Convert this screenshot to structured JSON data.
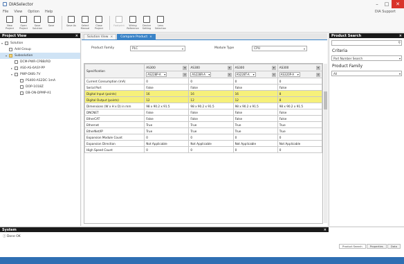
{
  "app": {
    "title": "DIASelector",
    "update_link": "DIA Support"
  },
  "menu": [
    "File",
    "View",
    "Option",
    "Help"
  ],
  "toolbar": [
    {
      "label": "New Project"
    },
    {
      "label": "Open Project"
    },
    {
      "label": "Save Solution"
    },
    {
      "label": "Save"
    },
    {
      "label": "Save As"
    },
    {
      "label": "Select Manual"
    },
    {
      "label": "Close Project"
    },
    {
      "label": "Footprint"
    },
    {
      "label": "Wiring Reference"
    },
    {
      "label": "Device Setting"
    },
    {
      "label": "Lens Selection"
    }
  ],
  "left_panel": {
    "title": "Project View",
    "nodes": [
      {
        "label": "Solution",
        "level": 0
      },
      {
        "label": "Add Group",
        "level": 1
      },
      {
        "label": "Subsolution",
        "level": 1
      },
      {
        "label": "DCM-PWR-CPBB/RD",
        "level": 2
      },
      {
        "label": "AS0-AS-6ASY-PP",
        "level": 2
      },
      {
        "label": "PWP-DI8S-7V",
        "level": 2
      },
      {
        "label": "PS400-AS2DC-1mA",
        "level": 3
      },
      {
        "label": "DOP-1018Z",
        "level": 3
      },
      {
        "label": "DB-ON-DPMP-A1",
        "level": 3
      }
    ]
  },
  "center": {
    "tabs": [
      {
        "label": "Solution View"
      },
      {
        "label": "Compare Product"
      }
    ],
    "filters": {
      "family_label": "Product Family",
      "family_value": "PLC",
      "type_label": "Module Type",
      "type_value": "CPU"
    },
    "columns": [
      {
        "series": "AS300",
        "model": "AS228P-A"
      },
      {
        "series": "AS300",
        "model": "AS228R-A"
      },
      {
        "series": "AS300",
        "model": "AS228T-A"
      },
      {
        "series": "AS300",
        "model": "AS320P-A"
      }
    ],
    "spec_header": "Specification",
    "rows": [
      {
        "label": "Current Consumption (mA)",
        "values": [
          "0",
          "0",
          "0",
          "0"
        ],
        "hl": false
      },
      {
        "label": "Serial Port",
        "values": [
          "False",
          "False",
          "False",
          "False"
        ],
        "hl": false
      },
      {
        "label": "Digital Input (points)",
        "values": [
          "16",
          "16",
          "16",
          "8"
        ],
        "hl": true
      },
      {
        "label": "Digital Output (points)",
        "values": [
          "12",
          "12",
          "12",
          "8"
        ],
        "hl": true
      },
      {
        "label": "Dimensions (W x H x D) in mm",
        "values": [
          "98 x 90.2 x 91.5",
          "98 x 90.2 x 91.5",
          "98 x 90.2 x 91.5",
          "98 x 90.2 x 91.5"
        ],
        "hl": false
      },
      {
        "label": "DNCNET",
        "values": [
          "False",
          "False",
          "False",
          "False"
        ],
        "hl": false
      },
      {
        "label": "EtherCAT",
        "values": [
          "False",
          "False",
          "False",
          "False"
        ],
        "hl": false
      },
      {
        "label": "Ethernet",
        "values": [
          "True",
          "True",
          "True",
          "True"
        ],
        "hl": false
      },
      {
        "label": "EtherNet/IP",
        "values": [
          "True",
          "True",
          "True",
          "True"
        ],
        "hl": false
      },
      {
        "label": "Expansion Module Count",
        "values": [
          "0",
          "0",
          "0",
          "0"
        ],
        "hl": false
      },
      {
        "label": "Expansion Direction",
        "values": [
          "Not Applicable",
          "Not Applicable",
          "Not Applicable",
          "Not Applicable"
        ],
        "hl": false
      },
      {
        "label": "High Speed Count",
        "values": [
          "0",
          "0",
          "0",
          "0"
        ],
        "hl": false
      }
    ]
  },
  "right_panel": {
    "title": "Product Search",
    "criteria_label": "Criteria",
    "criteria_value": "Part Number Search",
    "family_label": "Product Family",
    "family_value": "All"
  },
  "bottom": {
    "title": "System",
    "message": "Done OK",
    "tabs": [
      "Product Search",
      "Properties",
      "Data"
    ]
  }
}
